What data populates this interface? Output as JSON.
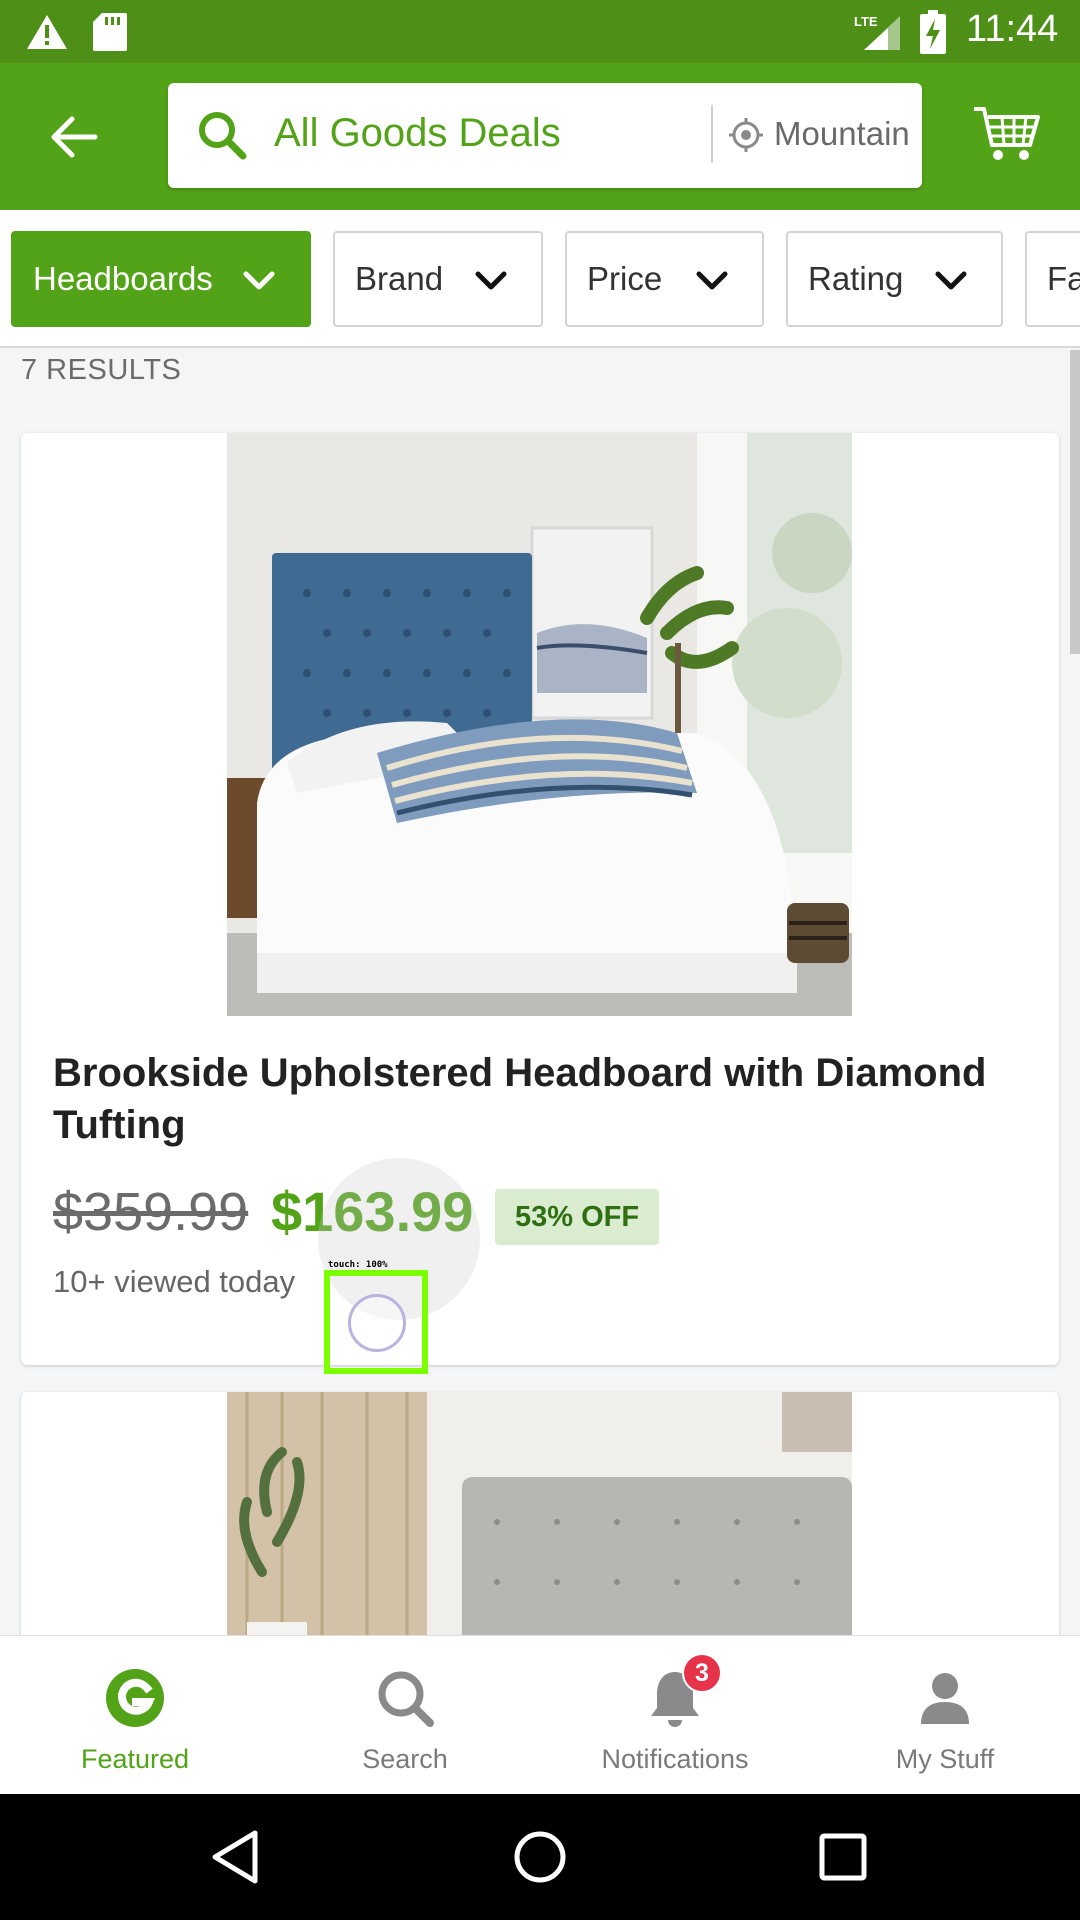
{
  "status_bar": {
    "time": "11:44",
    "network": "LTE",
    "icons": [
      "warning-icon",
      "sd-card-icon",
      "signal-icon",
      "battery-charging-icon"
    ]
  },
  "header": {
    "back_icon": "arrow-left-icon",
    "search_query": "All Goods Deals",
    "location": "Mountain",
    "cart_icon": "cart-icon"
  },
  "filters": [
    {
      "label": "Headboards",
      "active": true
    },
    {
      "label": "Brand",
      "active": false
    },
    {
      "label": "Price",
      "active": false
    },
    {
      "label": "Rating",
      "active": false
    },
    {
      "label": "Fa",
      "active": false
    }
  ],
  "results": {
    "count_label": "7 RESULTS"
  },
  "products": [
    {
      "title": "Brookside Upholstered Headboard with Diamond Tufting",
      "original_price": "$359.99",
      "sale_price": "$163.99",
      "discount": "53% OFF",
      "viewed": "10+ viewed today"
    }
  ],
  "touch_overlay": {
    "label": "touch: 100%"
  },
  "bottom_nav": [
    {
      "label": "Featured",
      "icon": "groupon-logo-icon",
      "active": true
    },
    {
      "label": "Search",
      "icon": "search-icon",
      "active": false
    },
    {
      "label": "Notifications",
      "icon": "bell-icon",
      "active": false,
      "badge": "3"
    },
    {
      "label": "My Stuff",
      "icon": "person-icon",
      "active": false
    }
  ],
  "colors": {
    "brand_green": "#53a318",
    "status_green": "#4d8f17",
    "badge_red": "#e6334a"
  }
}
